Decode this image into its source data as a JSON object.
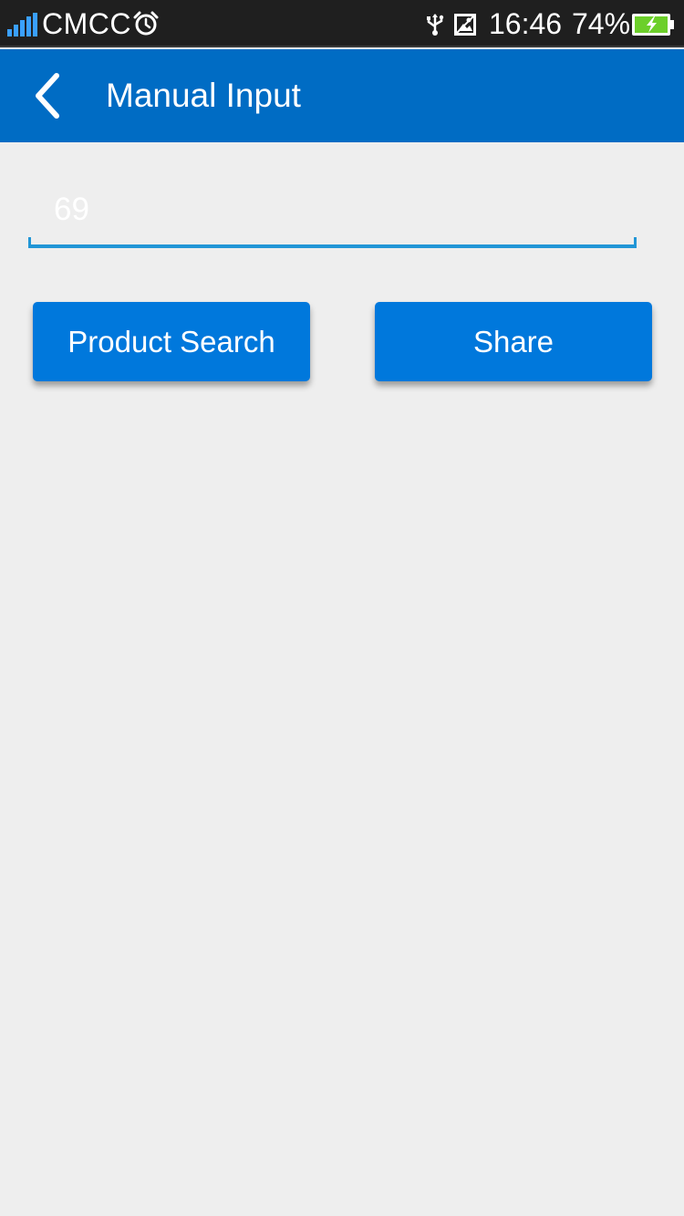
{
  "status_bar": {
    "carrier": "CMCC",
    "time": "16:46",
    "battery_percent": "74%",
    "icons": [
      "signal-icon",
      "alarm-icon",
      "usb-icon",
      "photo-icon",
      "battery-charging-icon"
    ]
  },
  "app_bar": {
    "title": "Manual Input",
    "back_icon": "chevron-left-icon"
  },
  "input": {
    "value": "69",
    "placeholder": ""
  },
  "buttons": {
    "product_search": "Product Search",
    "share": "Share"
  },
  "colors": {
    "app_bar": "#006cc4",
    "button": "#0078dc",
    "input_underline": "#2196d6",
    "background": "#eeeeee",
    "status_bar": "#1f1f1f",
    "signal": "#3aa0ff",
    "battery_fill": "#6ccf2a"
  }
}
